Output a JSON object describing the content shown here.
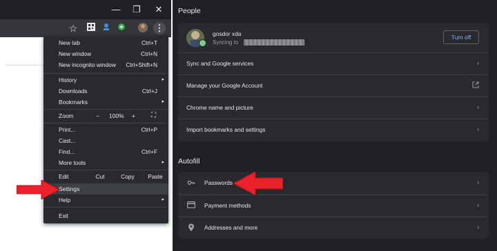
{
  "window": {
    "minimize": "—",
    "restore": "❐",
    "close": "✕"
  },
  "toolbar": {
    "star": "☆",
    "menu": "⋮"
  },
  "menu": {
    "items": [
      {
        "label": "New tab",
        "shortcut": "Ctrl+T"
      },
      {
        "label": "New window",
        "shortcut": "Ctrl+N"
      },
      {
        "label": "New incognito window",
        "shortcut": "Ctrl+Shift+N"
      },
      {
        "label": "History",
        "arrow": "▸"
      },
      {
        "label": "Downloads",
        "shortcut": "Ctrl+J"
      },
      {
        "label": "Bookmarks",
        "arrow": "▸"
      },
      {
        "label": "Print...",
        "shortcut": "Ctrl+P"
      },
      {
        "label": "Cast..."
      },
      {
        "label": "Find...",
        "shortcut": "Ctrl+F"
      },
      {
        "label": "More tools",
        "arrow": "▸"
      },
      {
        "label": "Settings"
      },
      {
        "label": "Help",
        "arrow": "▸"
      },
      {
        "label": "Exit"
      }
    ],
    "zoom": {
      "label": "Zoom",
      "minus": "−",
      "value": "100%",
      "plus": "+",
      "fullscreen": "⛶"
    },
    "edit": {
      "label": "Edit",
      "cut": "Cut",
      "copy": "Copy",
      "paste": "Paste"
    }
  },
  "people": {
    "title": "People",
    "user_name": "gosdor xda",
    "syncing": "Syncing to",
    "turn_off": "Turn off",
    "rows": [
      "Sync and Google services",
      "Manage your Google Account",
      "Chrome name and picture",
      "Import bookmarks and settings"
    ]
  },
  "autofill": {
    "title": "Autofill",
    "rows": [
      "Passwords",
      "Payment methods",
      "Addresses and more"
    ]
  },
  "colors": {
    "arrow": "#e8212a",
    "accent": "#8ab4f8",
    "panel": "#292a2d",
    "background": "#202124"
  }
}
